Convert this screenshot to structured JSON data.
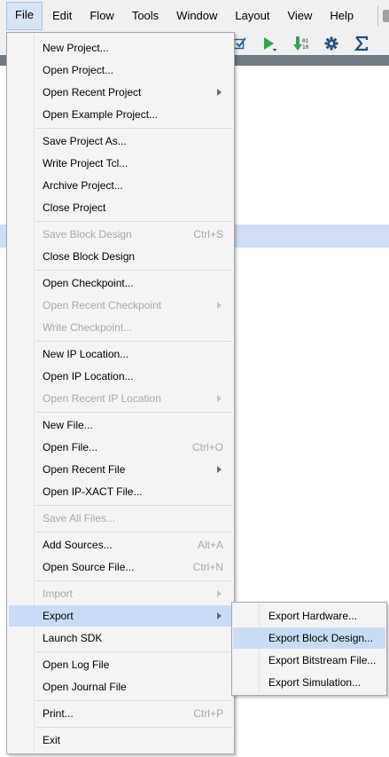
{
  "menubar": {
    "items": [
      {
        "label": "File"
      },
      {
        "label": "Edit"
      },
      {
        "label": "Flow"
      },
      {
        "label": "Tools"
      },
      {
        "label": "Window"
      },
      {
        "label": "Layout"
      },
      {
        "label": "View"
      },
      {
        "label": "Help"
      }
    ]
  },
  "toolbar": {
    "icons": [
      "checkbox-icon",
      "run-icon",
      "bitstream-icon",
      "settings-gear-icon",
      "sigma-icon"
    ]
  },
  "file_menu": {
    "items": [
      {
        "label": "New Project...",
        "accel": "",
        "submenu": false,
        "disabled": false
      },
      {
        "label": "Open Project...",
        "accel": "",
        "submenu": false,
        "disabled": false
      },
      {
        "label": "Open Recent Project",
        "accel": "",
        "submenu": true,
        "disabled": false
      },
      {
        "label": "Open Example Project...",
        "accel": "",
        "submenu": false,
        "disabled": false
      },
      {
        "label": "Save Project As...",
        "accel": "",
        "submenu": false,
        "disabled": false
      },
      {
        "label": "Write Project Tcl...",
        "accel": "",
        "submenu": false,
        "disabled": false
      },
      {
        "label": "Archive Project...",
        "accel": "",
        "submenu": false,
        "disabled": false
      },
      {
        "label": "Close Project",
        "accel": "",
        "submenu": false,
        "disabled": false
      },
      {
        "label": "Save Block Design",
        "accel": "Ctrl+S",
        "submenu": false,
        "disabled": true
      },
      {
        "label": "Close Block Design",
        "accel": "",
        "submenu": false,
        "disabled": false
      },
      {
        "label": "Open Checkpoint...",
        "accel": "",
        "submenu": false,
        "disabled": false
      },
      {
        "label": "Open Recent Checkpoint",
        "accel": "",
        "submenu": true,
        "disabled": true
      },
      {
        "label": "Write Checkpoint...",
        "accel": "",
        "submenu": false,
        "disabled": true
      },
      {
        "label": "New IP Location...",
        "accel": "",
        "submenu": false,
        "disabled": false
      },
      {
        "label": "Open IP Location...",
        "accel": "",
        "submenu": false,
        "disabled": false
      },
      {
        "label": "Open Recent IP Location",
        "accel": "",
        "submenu": true,
        "disabled": true
      },
      {
        "label": "New File...",
        "accel": "",
        "submenu": false,
        "disabled": false
      },
      {
        "label": "Open File...",
        "accel": "Ctrl+O",
        "submenu": false,
        "disabled": false
      },
      {
        "label": "Open Recent File",
        "accel": "",
        "submenu": true,
        "disabled": false
      },
      {
        "label": "Open IP-XACT File...",
        "accel": "",
        "submenu": false,
        "disabled": false
      },
      {
        "label": "Save All Files...",
        "accel": "",
        "submenu": false,
        "disabled": true
      },
      {
        "label": "Add Sources...",
        "accel": "Alt+A",
        "submenu": false,
        "disabled": false
      },
      {
        "label": "Open Source File...",
        "accel": "Ctrl+N",
        "submenu": false,
        "disabled": false
      },
      {
        "label": "Import",
        "accel": "",
        "submenu": true,
        "disabled": true
      },
      {
        "label": "Export",
        "accel": "",
        "submenu": true,
        "disabled": false,
        "selected": true
      },
      {
        "label": "Launch SDK",
        "accel": "",
        "submenu": false,
        "disabled": false
      },
      {
        "label": "Open Log File",
        "accel": "",
        "submenu": false,
        "disabled": false
      },
      {
        "label": "Open Journal File",
        "accel": "",
        "submenu": false,
        "disabled": false
      },
      {
        "label": "Print...",
        "accel": "Ctrl+P",
        "submenu": false,
        "disabled": false
      },
      {
        "label": "Exit",
        "accel": "",
        "submenu": false,
        "disabled": false
      }
    ]
  },
  "export_submenu": {
    "items": [
      {
        "label": "Export Hardware..."
      },
      {
        "label": "Export Block Design...",
        "selected": true
      },
      {
        "label": "Export Bitstream File..."
      },
      {
        "label": "Export Simulation..."
      }
    ]
  },
  "colors": {
    "menu_bg": "#f4f4f4",
    "selection": "#c9dcf7",
    "disabled_text": "#a8a8a8",
    "run_green": "#2fa84f"
  }
}
